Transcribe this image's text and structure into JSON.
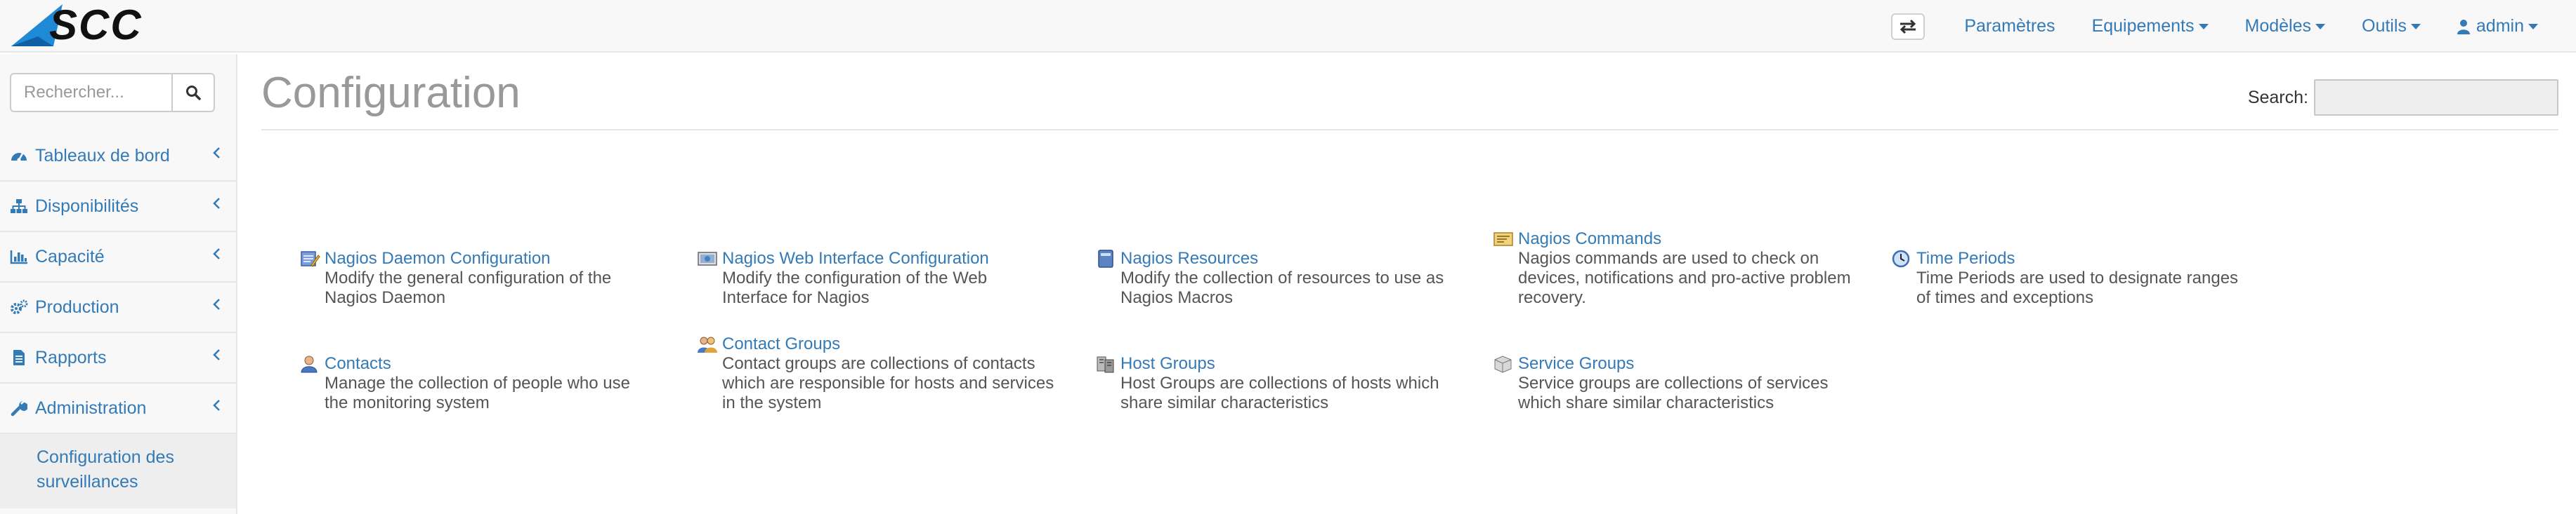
{
  "brand": {
    "name": "SCC"
  },
  "navbar": {
    "items": [
      {
        "label": "Paramètres",
        "dropdown": false
      },
      {
        "label": "Equipements",
        "dropdown": true
      },
      {
        "label": "Modèles",
        "dropdown": true
      },
      {
        "label": "Outils",
        "dropdown": true
      },
      {
        "label": "admin",
        "dropdown": true
      }
    ],
    "toggle_icon": "swap-arrows-icon",
    "user_icon": "user-icon"
  },
  "sidebar": {
    "search_placeholder": "Rechercher...",
    "search_icon": "search-icon",
    "items": [
      {
        "label": "Tableaux de bord",
        "icon": "dashboard-icon"
      },
      {
        "label": "Disponibilités",
        "icon": "sitemap-icon"
      },
      {
        "label": "Capacité",
        "icon": "bar-chart-icon"
      },
      {
        "label": "Production",
        "icon": "cogs-icon"
      },
      {
        "label": "Rapports",
        "icon": "file-text-icon"
      },
      {
        "label": "Administration",
        "icon": "wrench-icon"
      }
    ],
    "submenu": {
      "label": "Configuration des surveillances"
    }
  },
  "main": {
    "title": "Configuration",
    "search_label": "Search:",
    "items": [
      {
        "label": "Nagios Daemon Configuration",
        "desc": "Modify the general configuration of the Nagios Daemon",
        "icon": "daemon-config-icon"
      },
      {
        "label": "Nagios Web Interface Configuration",
        "desc": "Modify the configuration of the Web Interface for Nagios",
        "icon": "web-interface-icon"
      },
      {
        "label": "Nagios Resources",
        "desc": "Modify the collection of resources to use as Nagios Macros",
        "icon": "resources-book-icon"
      },
      {
        "label": "Nagios Commands",
        "desc": "Nagios commands are used to check on devices, notifications and pro-active problem recovery.",
        "icon": "commands-icon"
      },
      {
        "label": "Time Periods",
        "desc": "Time Periods are used to designate ranges of times and exceptions",
        "icon": "clock-icon"
      },
      {
        "label": "Contacts",
        "desc": "Manage the collection of people who use the monitoring system",
        "icon": "contact-person-icon"
      },
      {
        "label": "Contact Groups",
        "desc": "Contact groups are collections of contacts which are responsible for hosts and services in the system",
        "icon": "contact-group-icon"
      },
      {
        "label": "Host Groups",
        "desc": "Host Groups are collections of hosts which share similar characteristics",
        "icon": "host-group-icon"
      },
      {
        "label": "Service Groups",
        "desc": "Service groups are collections of services which share similar characteristics",
        "icon": "service-group-icon"
      }
    ]
  },
  "colors": {
    "link": "#337ab7",
    "navbar_bg": "#f8f8f8",
    "title": "#999999",
    "submenu_bg": "#eeeeee"
  }
}
